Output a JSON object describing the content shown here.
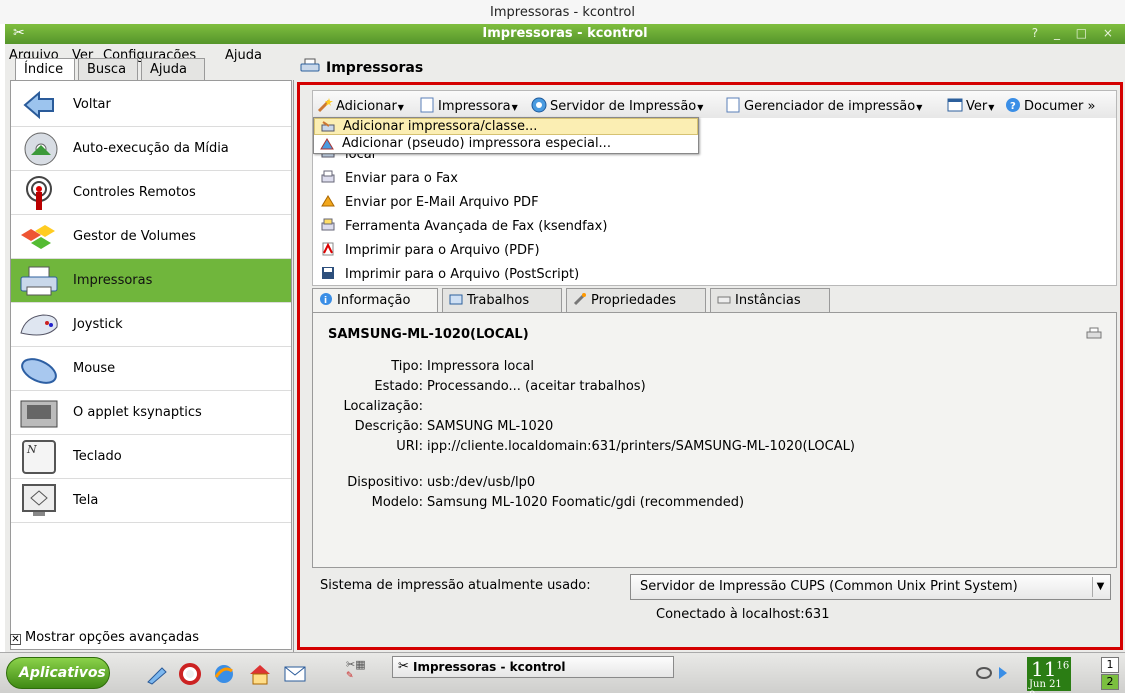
{
  "top_banner": "Impressoras - kcontrol",
  "window": {
    "title": "Impressoras - kcontrol",
    "buttons": "? _ □ ×"
  },
  "menu": [
    "Arquivo",
    "Ver",
    "Configurações",
    "Ajuda"
  ],
  "left_tabs": [
    "Índice",
    "Busca",
    "Ajuda"
  ],
  "sidebar": {
    "items": [
      {
        "label": "Voltar",
        "icon": "back-arrow-icon"
      },
      {
        "label": "Auto-execução da Mídia",
        "icon": "media-autorun-icon"
      },
      {
        "label": "Controles Remotos",
        "icon": "remote-control-icon"
      },
      {
        "label": "Gestor de Volumes",
        "icon": "volumes-icon"
      },
      {
        "label": "Impressoras",
        "icon": "printer-icon"
      },
      {
        "label": "Joystick",
        "icon": "joystick-icon"
      },
      {
        "label": "Mouse",
        "icon": "mouse-icon"
      },
      {
        "label": "O applet ksynaptics",
        "icon": "touchpad-icon"
      },
      {
        "label": "Teclado",
        "icon": "keyboard-icon"
      },
      {
        "label": "Tela",
        "icon": "display-icon"
      }
    ],
    "selected": "Impressoras",
    "footer_checkbox": "Mostrar opções avançadas",
    "footer_checked": true
  },
  "main": {
    "heading": "Impressoras",
    "toolbar": [
      {
        "label": "Adicionar",
        "icon": "wand-icon"
      },
      {
        "label": "Impressora",
        "icon": "page-icon"
      },
      {
        "label": "Servidor de Impressão",
        "icon": "server-icon"
      },
      {
        "label": "Gerenciador de impressão",
        "icon": "page-icon"
      },
      {
        "label": "Ver",
        "icon": "view-icon"
      },
      {
        "label": "Documer »",
        "icon": "help-icon"
      }
    ],
    "dropdown": [
      {
        "label": "Adicionar impressora/classe...",
        "highlighted": true
      },
      {
        "label": "Adicionar (pseudo) impressora especial...",
        "highlighted": false
      }
    ],
    "printers": [
      {
        "label": "local",
        "icon": "printer-icon"
      },
      {
        "label": "Enviar para o Fax",
        "icon": "fax-icon"
      },
      {
        "label": "Enviar por E-Mail Arquivo PDF",
        "icon": "email-pdf-icon"
      },
      {
        "label": "Ferramenta Avançada de Fax (ksendfax)",
        "icon": "fax-tool-icon"
      },
      {
        "label": "Imprimir para o Arquivo (PDF)",
        "icon": "pdf-icon"
      },
      {
        "label": "Imprimir para o Arquivo (PostScript)",
        "icon": "save-icon"
      }
    ],
    "tabs": [
      {
        "label": "Informação",
        "icon": "info-icon"
      },
      {
        "label": "Trabalhos",
        "icon": "jobs-icon"
      },
      {
        "label": "Propriedades",
        "icon": "properties-icon"
      },
      {
        "label": "Instâncias",
        "icon": "instances-icon"
      }
    ],
    "active_tab": "Informação",
    "info": {
      "title": "SAMSUNG-ML-1020(LOCAL)",
      "fields": [
        {
          "key": "Tipo:",
          "value": "Impressora local"
        },
        {
          "key": "Estado:",
          "value": "Processando... (aceitar trabalhos)"
        },
        {
          "key": "Localização:",
          "value": ""
        },
        {
          "key": "Descrição:",
          "value": "SAMSUNG ML-1020"
        },
        {
          "key": "URI:",
          "value": "ipp://cliente.localdomain:631/printers/SAMSUNG-ML-1020(LOCAL)"
        },
        {
          "key": "",
          "value": ""
        },
        {
          "key": "Dispositivo:",
          "value": "usb:/dev/usb/lp0"
        },
        {
          "key": "Modelo:",
          "value": "Samsung ML-1020 Foomatic/gdi (recommended)"
        }
      ]
    },
    "system_label": "Sistema de impressão atualmente usado:",
    "system_value": "Servidor de Impressão CUPS (Common Unix Print System)",
    "connection": "Conectado à localhost:631"
  },
  "taskbar": {
    "start": "Aplicativos",
    "task": "Impressoras - kcontrol",
    "clock_time": "11",
    "clock_minutes": "16",
    "clock_date": "Jun 21 0",
    "desktops": [
      "1",
      "2"
    ]
  },
  "colors": {
    "accent_green": "#70b63c",
    "frame_red": "#d40000",
    "highlight": "#fbeeb3"
  }
}
